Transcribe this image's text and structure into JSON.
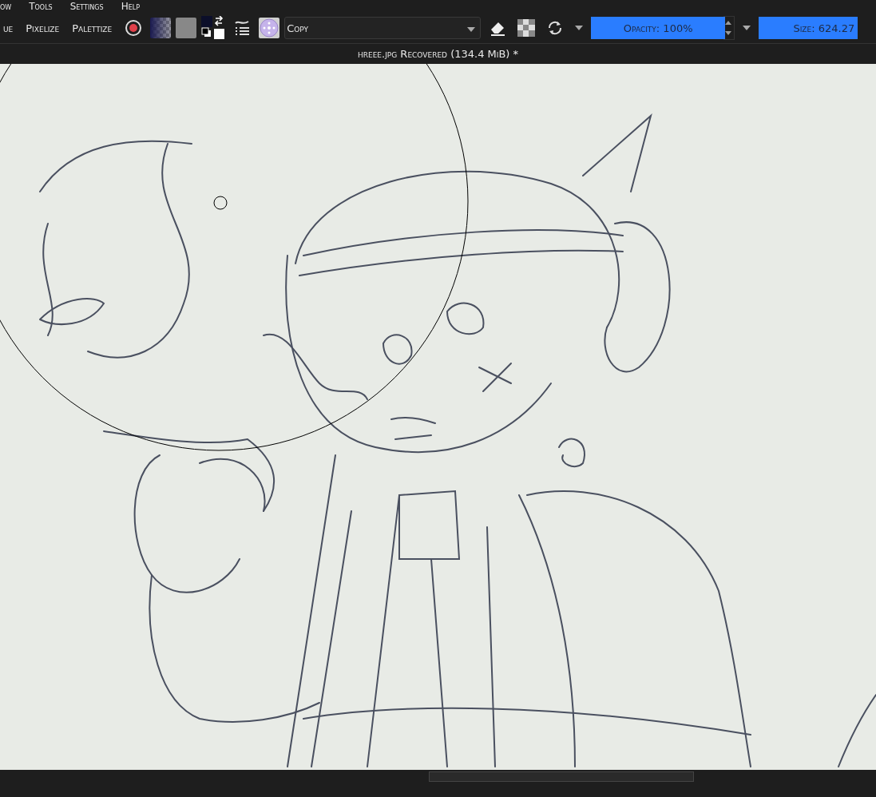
{
  "menu": [
    "ow",
    "Tools",
    "Settings",
    "Help"
  ],
  "toolbar": {
    "filters": [
      "ue",
      "Pixelize",
      "Palettize"
    ],
    "blend_mode": "Copy",
    "opacity": {
      "label": "Opacity: 100%",
      "level": 1
    },
    "size": {
      "label": "Size: 624.27",
      "level": 1
    }
  },
  "document_title": "hreee.jpg Recovered (134.4 MiB) *"
}
